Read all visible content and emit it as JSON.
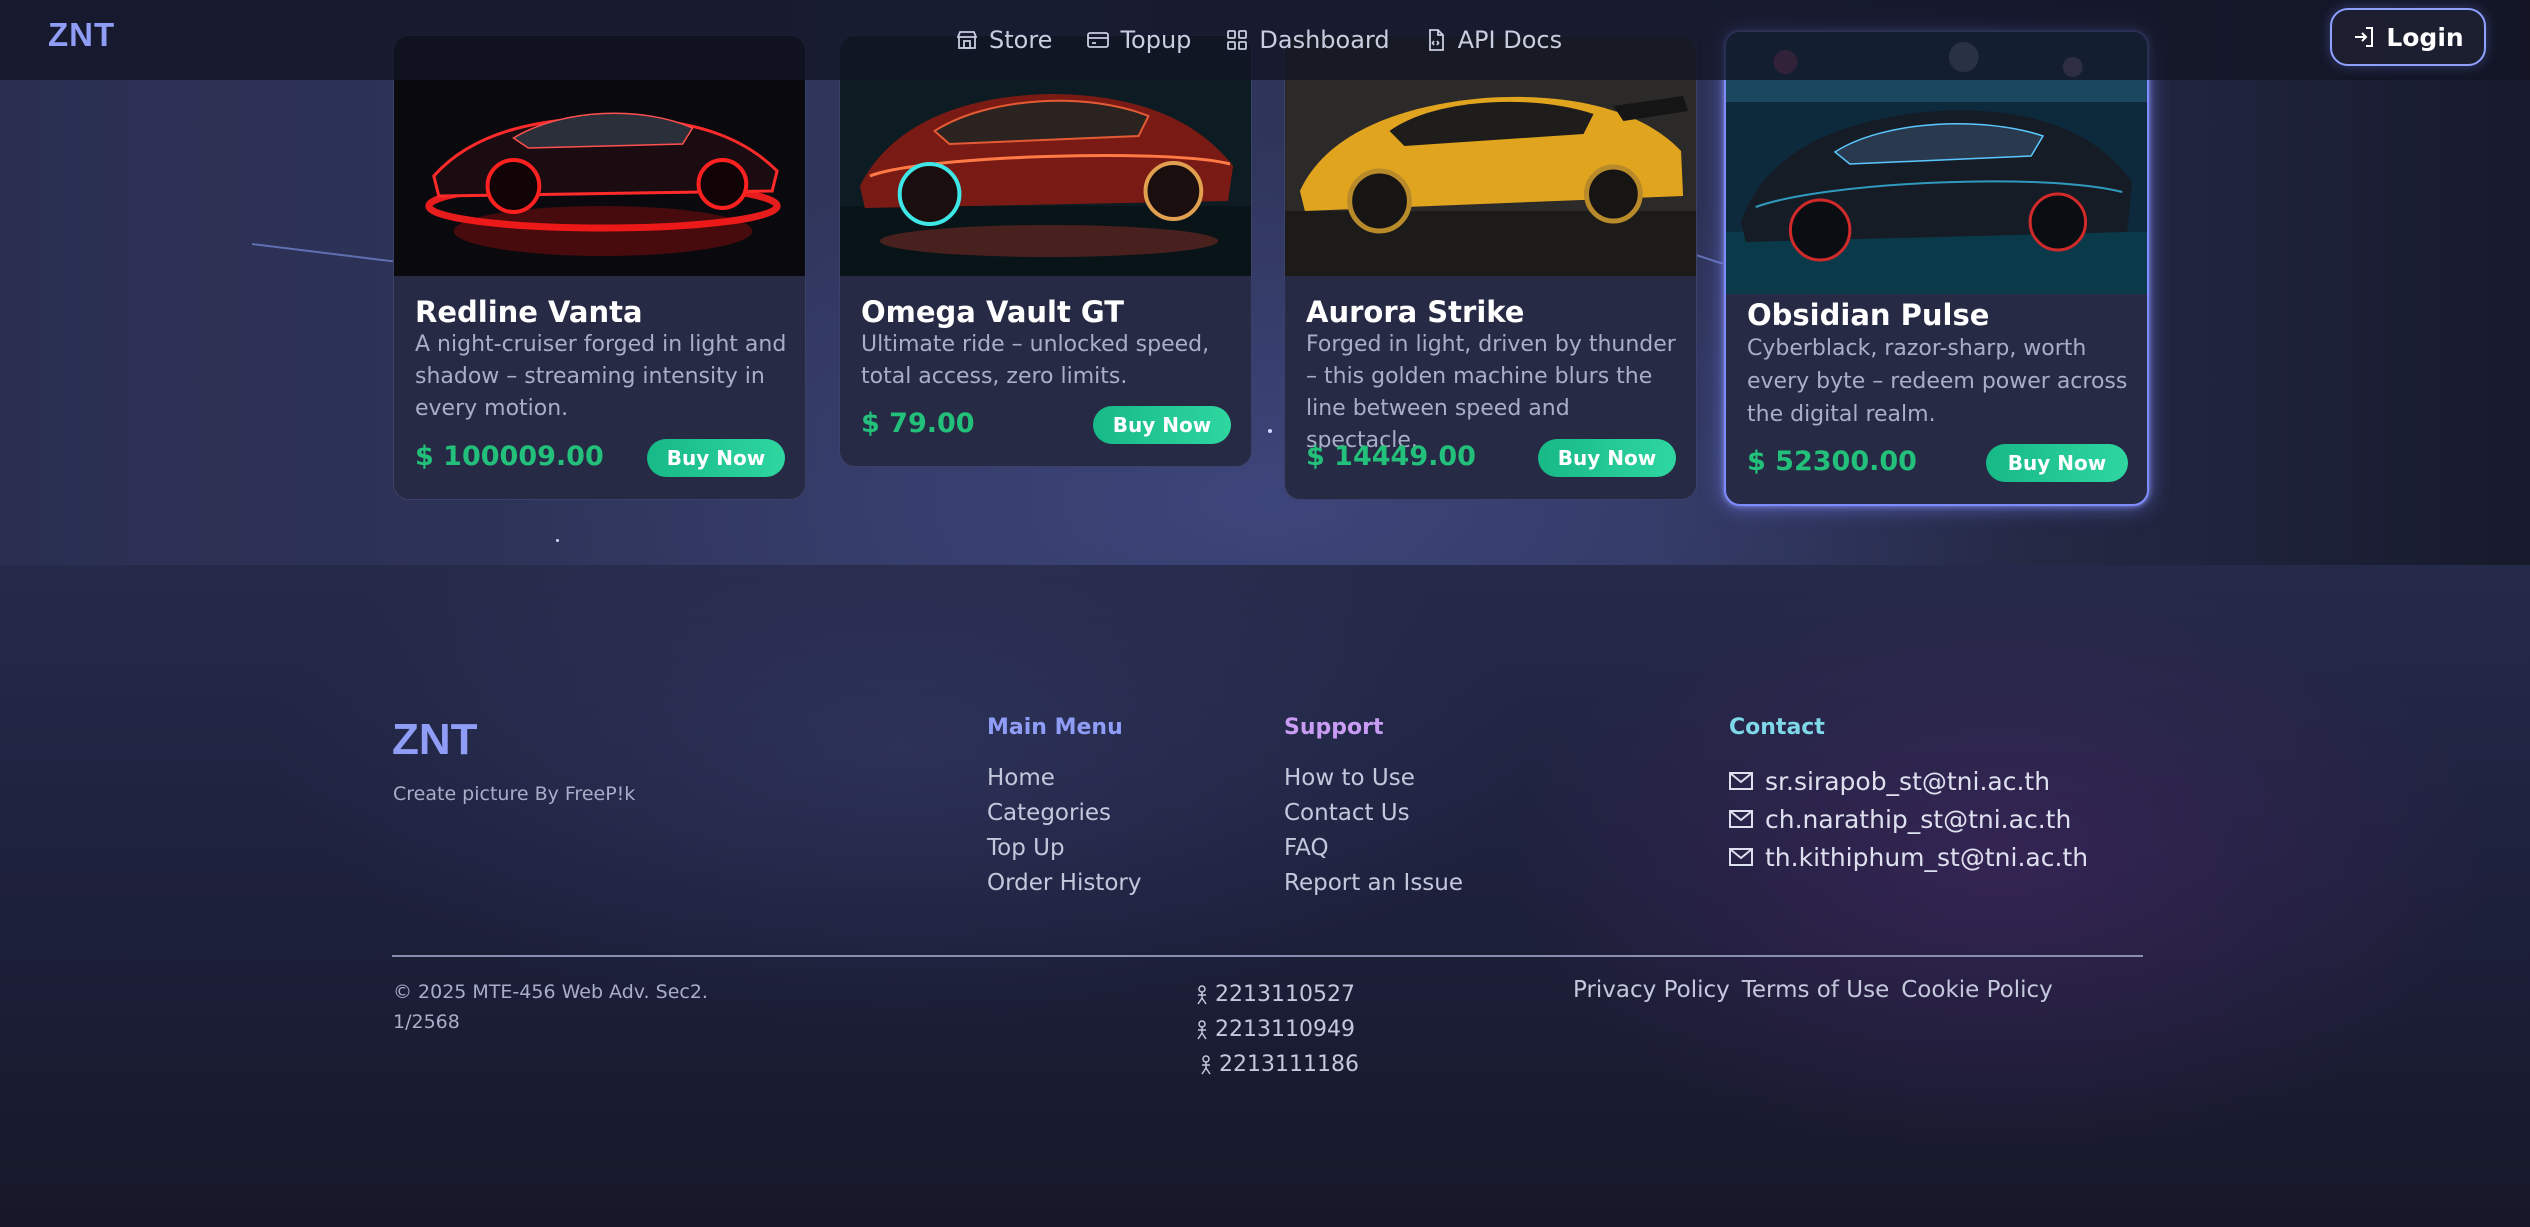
{
  "brand": {
    "name": "ZNT"
  },
  "nav": {
    "links": [
      {
        "label": "Store",
        "icon": "store-icon"
      },
      {
        "label": "Topup",
        "icon": "card-icon"
      },
      {
        "label": "Dashboard",
        "icon": "grid-icon"
      },
      {
        "label": "API Docs",
        "icon": "document-icon"
      }
    ],
    "login_label": "Login"
  },
  "products": [
    {
      "title": "Redline Vanta",
      "description": "A night-cruiser forged in light and shadow – streaming intensity in every motion.",
      "price": "$ 100009.00",
      "buy_label": "Buy Now",
      "image": "red-neon-supercar"
    },
    {
      "title": "Omega Vault GT",
      "description": "Ultimate ride – unlocked speed, total access, zero limits.",
      "price": "$ 79.00",
      "buy_label": "Buy Now",
      "image": "crimson-gt-supercar"
    },
    {
      "title": "Aurora Strike",
      "description": "Forged in light, driven by thunder – this golden machine blurs the line between speed and spectacle.",
      "price": "$ 14449.00",
      "buy_label": "Buy Now",
      "image": "gold-hypercar"
    },
    {
      "title": "Obsidian Pulse",
      "description": "Cyberblack, razor-sharp, worth every byte – redeem power across the digital realm.",
      "price": "$ 52300.00",
      "buy_label": "Buy Now",
      "image": "black-cyber-supercar"
    }
  ],
  "footer": {
    "logo": "ZNT",
    "credit": "Create picture By FreeP!k",
    "main_menu": {
      "title": "Main Menu",
      "items": [
        "Home",
        "Categories",
        "Top Up",
        "Order History"
      ]
    },
    "support": {
      "title": "Support",
      "items": [
        "How to Use",
        "Contact Us",
        "FAQ",
        "Report an Issue"
      ]
    },
    "contact": {
      "title": "Contact",
      "emails": [
        "sr.sirapob_st@tni.ac.th",
        "ch.narathip_st@tni.ac.th",
        "th.kithiphum_st@tni.ac.th"
      ]
    },
    "copyright": "© 2025 MTE-456 Web Adv. Sec2. 1/2568",
    "student_ids": [
      "2213110527",
      "2213110949",
      "2213111186"
    ],
    "policies": [
      "Privacy Policy",
      "Terms of Use",
      "Cookie Policy"
    ]
  },
  "colors": {
    "brand": "#8f9df7",
    "price": "#22c07a",
    "buy_button": "#1fc28e",
    "main_menu_title": "#8f9df7",
    "support_title": "#c79cf2",
    "contact_title": "#7ed8e8"
  }
}
